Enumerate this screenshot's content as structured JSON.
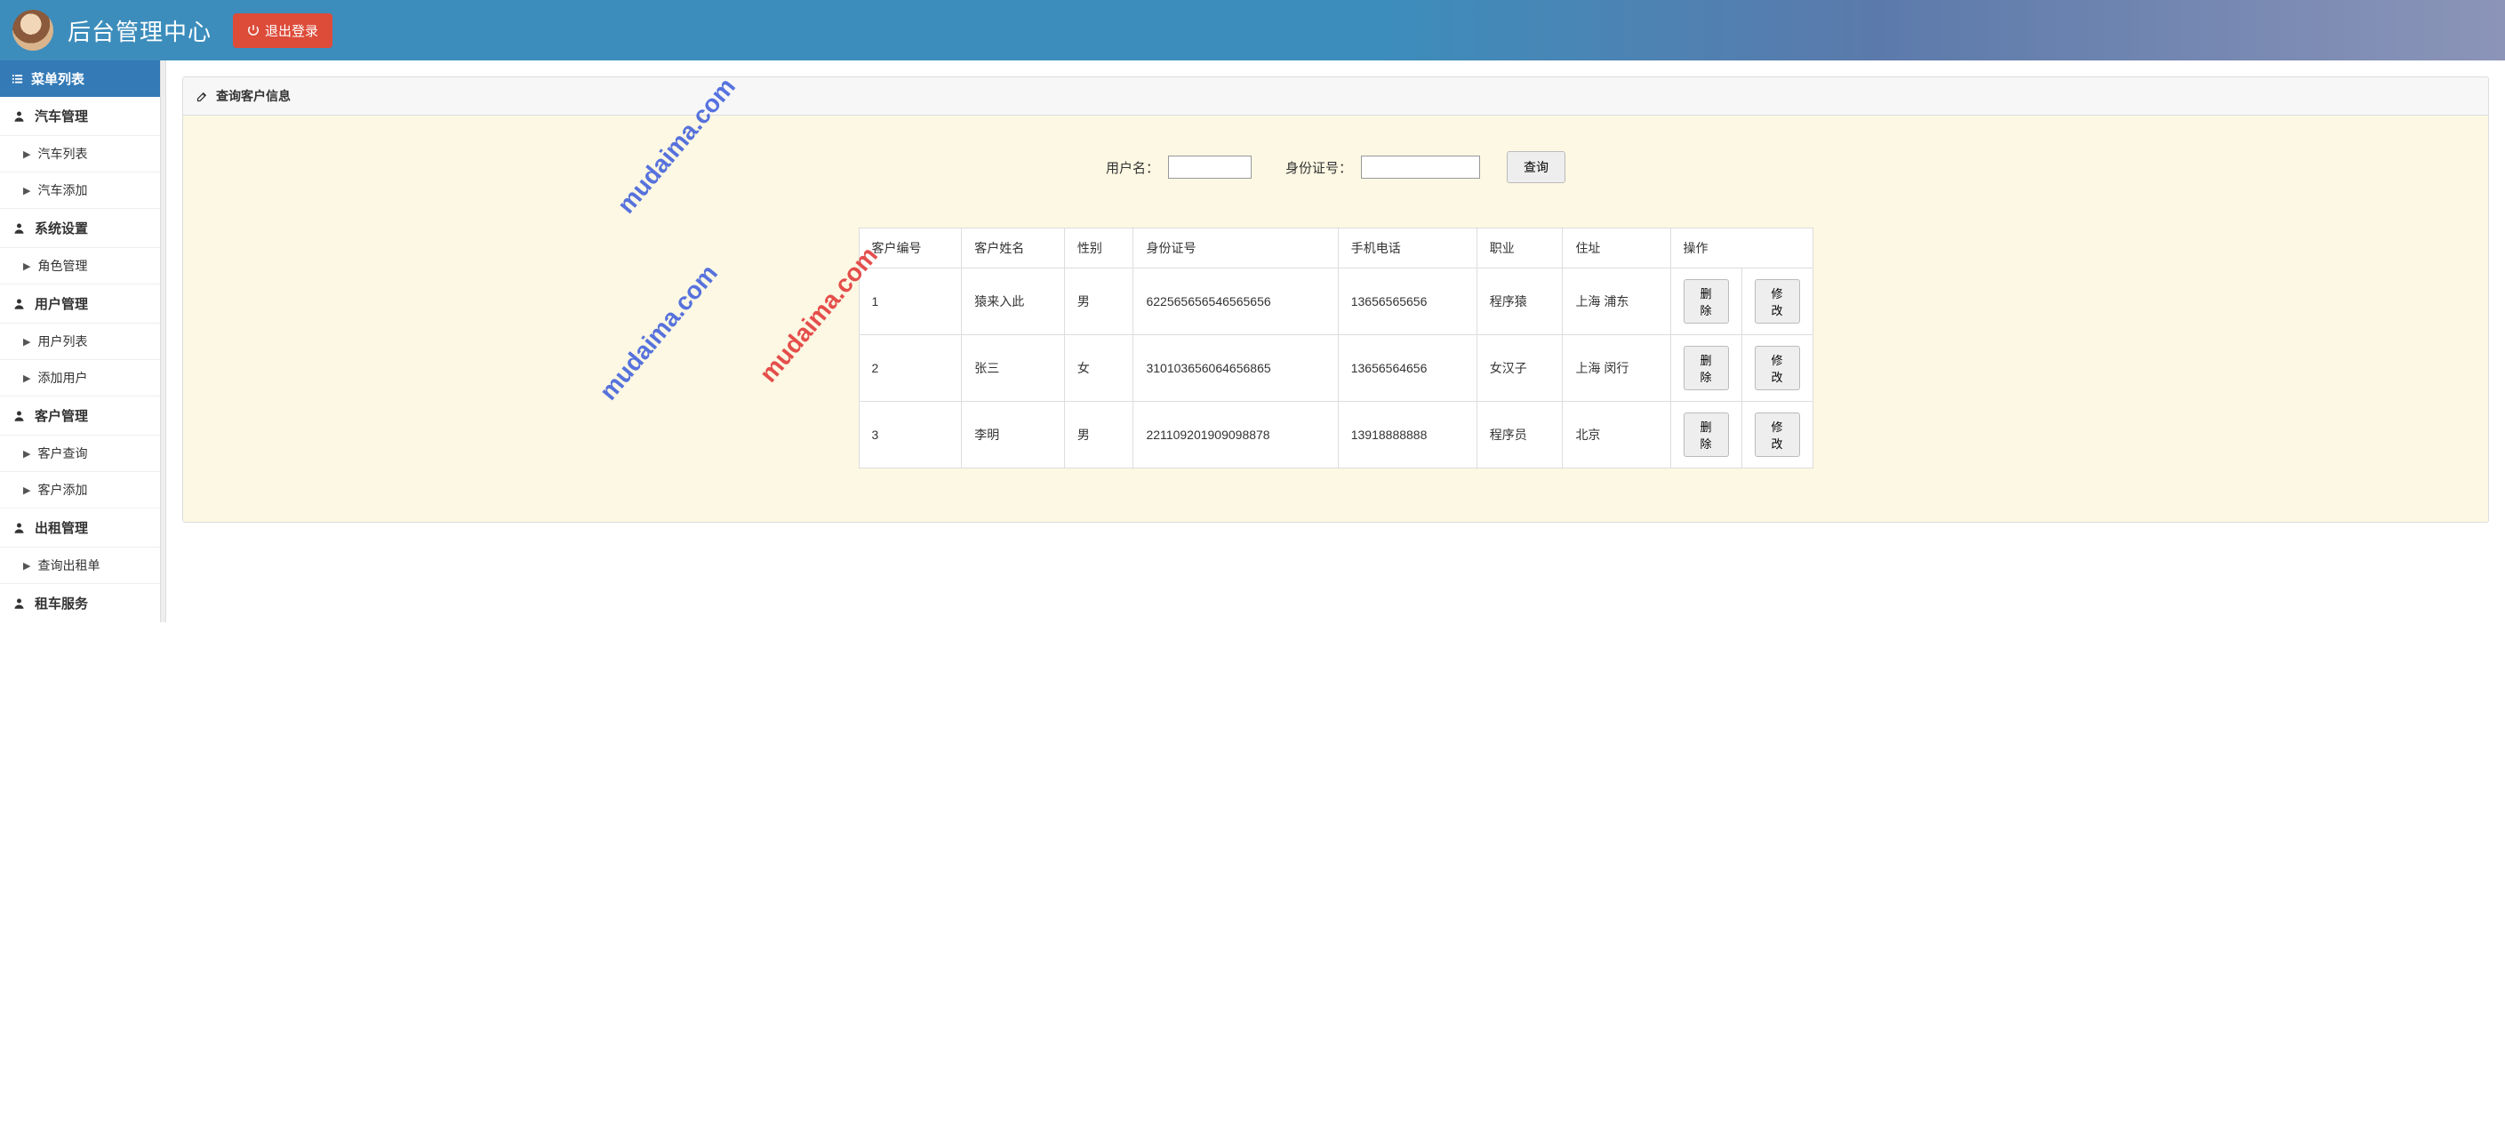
{
  "header": {
    "title": "后台管理中心",
    "logout_label": "退出登录"
  },
  "sidebar": {
    "menu_header": "菜单列表",
    "groups": [
      {
        "label": "汽车管理",
        "items": [
          {
            "label": "汽车列表"
          },
          {
            "label": "汽车添加"
          }
        ]
      },
      {
        "label": "系统设置",
        "items": [
          {
            "label": "角色管理"
          }
        ]
      },
      {
        "label": "用户管理",
        "items": [
          {
            "label": "用户列表"
          },
          {
            "label": "添加用户"
          }
        ]
      },
      {
        "label": "客户管理",
        "items": [
          {
            "label": "客户查询"
          },
          {
            "label": "客户添加"
          }
        ]
      },
      {
        "label": "出租管理",
        "items": [
          {
            "label": "查询出租单"
          }
        ]
      },
      {
        "label": "租车服务",
        "items": []
      }
    ]
  },
  "panel": {
    "title": "查询客户信息",
    "search": {
      "username_label": "用户名：",
      "username_value": "",
      "idcard_label": "身份证号：",
      "idcard_value": "",
      "submit_label": "查询"
    },
    "table": {
      "headers": [
        "客户编号",
        "客户姓名",
        "性别",
        "身份证号",
        "手机电话",
        "职业",
        "住址",
        "操作"
      ],
      "delete_label": "删除",
      "edit_label": "修改",
      "rows": [
        {
          "id": "1",
          "name": "猿来入此",
          "gender": "男",
          "idcard": "622565656546565656",
          "phone": "13656565656",
          "job": "程序猿",
          "addr": "上海 浦东"
        },
        {
          "id": "2",
          "name": "张三",
          "gender": "女",
          "idcard": "310103656064656865",
          "phone": "13656564656",
          "job": "女汉子",
          "addr": "上海 闵行"
        },
        {
          "id": "3",
          "name": "李明",
          "gender": "男",
          "idcard": "221109201909098878",
          "phone": "13918888888",
          "job": "程序员",
          "addr": "北京"
        }
      ]
    }
  },
  "watermark": "mudaima.com"
}
